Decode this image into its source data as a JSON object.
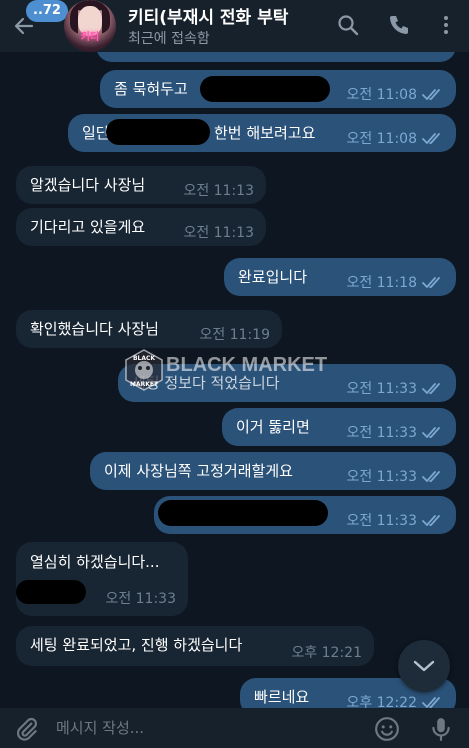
{
  "header": {
    "unread_count": "..72",
    "avatar_logo_text": "키티",
    "title": "키티(부재시 전화 부탁",
    "status": "최근에 접속함"
  },
  "messages": [
    {
      "direction": "out",
      "text": "좀 묵혀두고",
      "time": "오전 11:08",
      "redacted": true
    },
    {
      "direction": "out",
      "text_before": "일단",
      "text_after": "한번 해보려고요",
      "time": "오전 11:08",
      "redacted": true
    },
    {
      "direction": "in",
      "text": "알겠습니다 사장님",
      "time": "오전 11:13"
    },
    {
      "direction": "in",
      "text": "기다리고 있을게요",
      "time": "오전 11:13"
    },
    {
      "direction": "out",
      "text": "완료입니다",
      "time": "오전 11:18"
    },
    {
      "direction": "in",
      "text": "확인했습니다 사장님",
      "time": "오전 11:19"
    },
    {
      "direction": "out",
      "text": "세팅 정보다 적었습니다",
      "time": "오전 11:33"
    },
    {
      "direction": "out",
      "text": "이거 뚫리면",
      "time": "오전 11:33"
    },
    {
      "direction": "out",
      "text": "이제 사장님쪽 고정거래할게요",
      "time": "오전 11:33"
    },
    {
      "direction": "out",
      "text": "",
      "time": "오전 11:33",
      "redacted": true
    },
    {
      "direction": "in",
      "text": "열심히 하겠습니다...",
      "time": "오전 11:33",
      "redacted": true
    },
    {
      "direction": "in",
      "text": "세팅 완료되었고, 진행 하겠습니다",
      "time": "오후 12:21"
    },
    {
      "direction": "out",
      "text": "빠르네요",
      "time": "오후 12:22"
    }
  ],
  "watermark": {
    "text": "BLACK MARKET",
    "badge_top": "BLACK",
    "badge_bottom": "MARKET"
  },
  "composer": {
    "placeholder": "메시지 작성..."
  },
  "colors": {
    "background": "#0e1621",
    "header": "#17212b",
    "incoming_bubble": "#182533",
    "outgoing_bubble": "#2b5278",
    "accent": "#4d8fd1",
    "read_check": "#7da8d3"
  },
  "icons": [
    "back-arrow-icon",
    "search-icon",
    "phone-icon",
    "more-vertical-icon",
    "read-double-check-icon",
    "chevron-down-icon",
    "paperclip-icon",
    "emoji-icon",
    "microphone-icon"
  ]
}
